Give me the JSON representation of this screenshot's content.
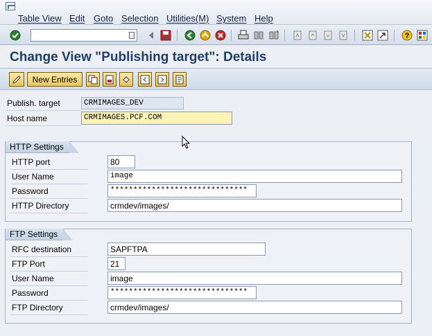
{
  "menu": {
    "items": [
      "Table View",
      "Edit",
      "Goto",
      "Selection",
      "Utilities(M)",
      "System",
      "Help"
    ]
  },
  "toolbar": {
    "command_value": "",
    "icons": [
      "enter-icon",
      "back-arrow-icon",
      "save-icon",
      "back-icon",
      "exit-icon",
      "cancel-icon",
      "print-icon",
      "find-icon",
      "find-next-icon",
      "first-page-icon",
      "previous-page-icon",
      "next-page-icon",
      "last-page-icon",
      "create-session-icon",
      "shortcut-icon",
      "help-icon",
      "layout-menu-icon"
    ]
  },
  "title": "Change View \"Publishing target\": Details",
  "app_toolbar": {
    "new_entries_label": "New Entries"
  },
  "header_fields": {
    "publish_target_label": "Publish. target",
    "publish_target_value": "CRMIMAGES_DEV",
    "host_name_label": "Host name",
    "host_name_value": "CRMIMAGES.PCF.COM"
  },
  "http": {
    "title": "HTTP Settings",
    "port_label": "HTTP port",
    "port_value": "80",
    "user_label": "User Name",
    "user_value": "image",
    "password_label": "Password",
    "password_value": "******************************",
    "directory_label": "HTTP Directory",
    "directory_value": "crmdev/images/"
  },
  "ftp": {
    "title": "FTP Settings",
    "rfc_label": "RFC destination",
    "rfc_value": "SAPFTPA",
    "port_label": "FTP Port",
    "port_value": "21",
    "user_label": "User Name",
    "user_value": "image",
    "password_label": "Password",
    "password_value": "******************************",
    "directory_label": "FTP Directory",
    "directory_value": "crmdev/images/"
  },
  "colors": {
    "title": "#1f3e6a",
    "highlight_field": "#fff4b8",
    "button_yellow": "#e8c65a"
  }
}
